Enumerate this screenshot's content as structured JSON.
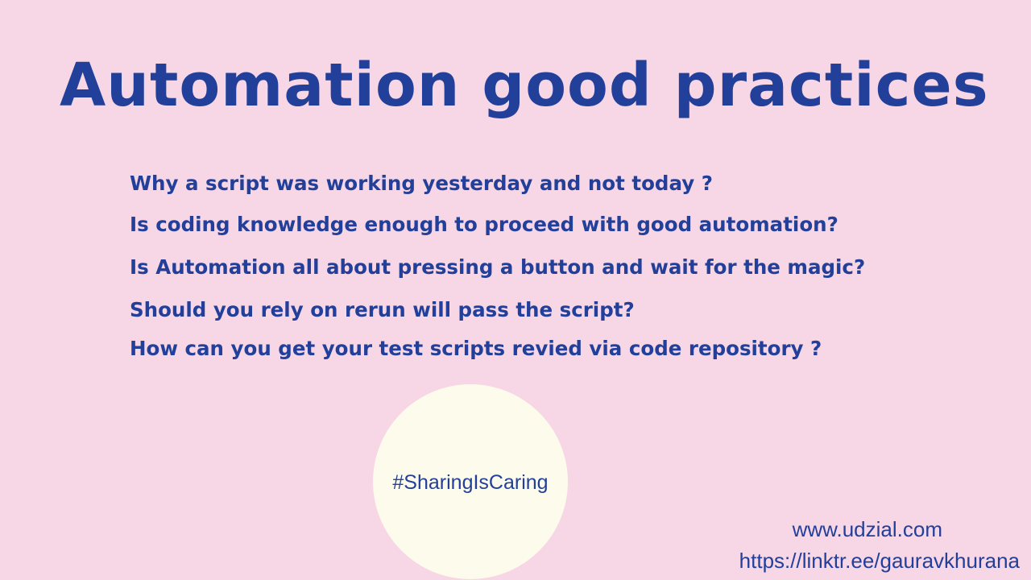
{
  "slide": {
    "title": "Automation good practices",
    "questions": [
      "Why a script was working yesterday and not today ?",
      "Is coding knowledge enough to proceed with good automation?",
      "Is Automation all about pressing a button and wait for the magic?",
      "Should you rely on rerun will pass the script?",
      "How can you get your test scripts revied via code repository ?"
    ],
    "hashtag": "#SharingIsCaring",
    "website": "www.udzial.com",
    "link": "https://linktr.ee/gauravkhurana"
  },
  "colors": {
    "background": "#f7d6e6",
    "text": "#22409a",
    "circle": "#fdfbeb"
  }
}
